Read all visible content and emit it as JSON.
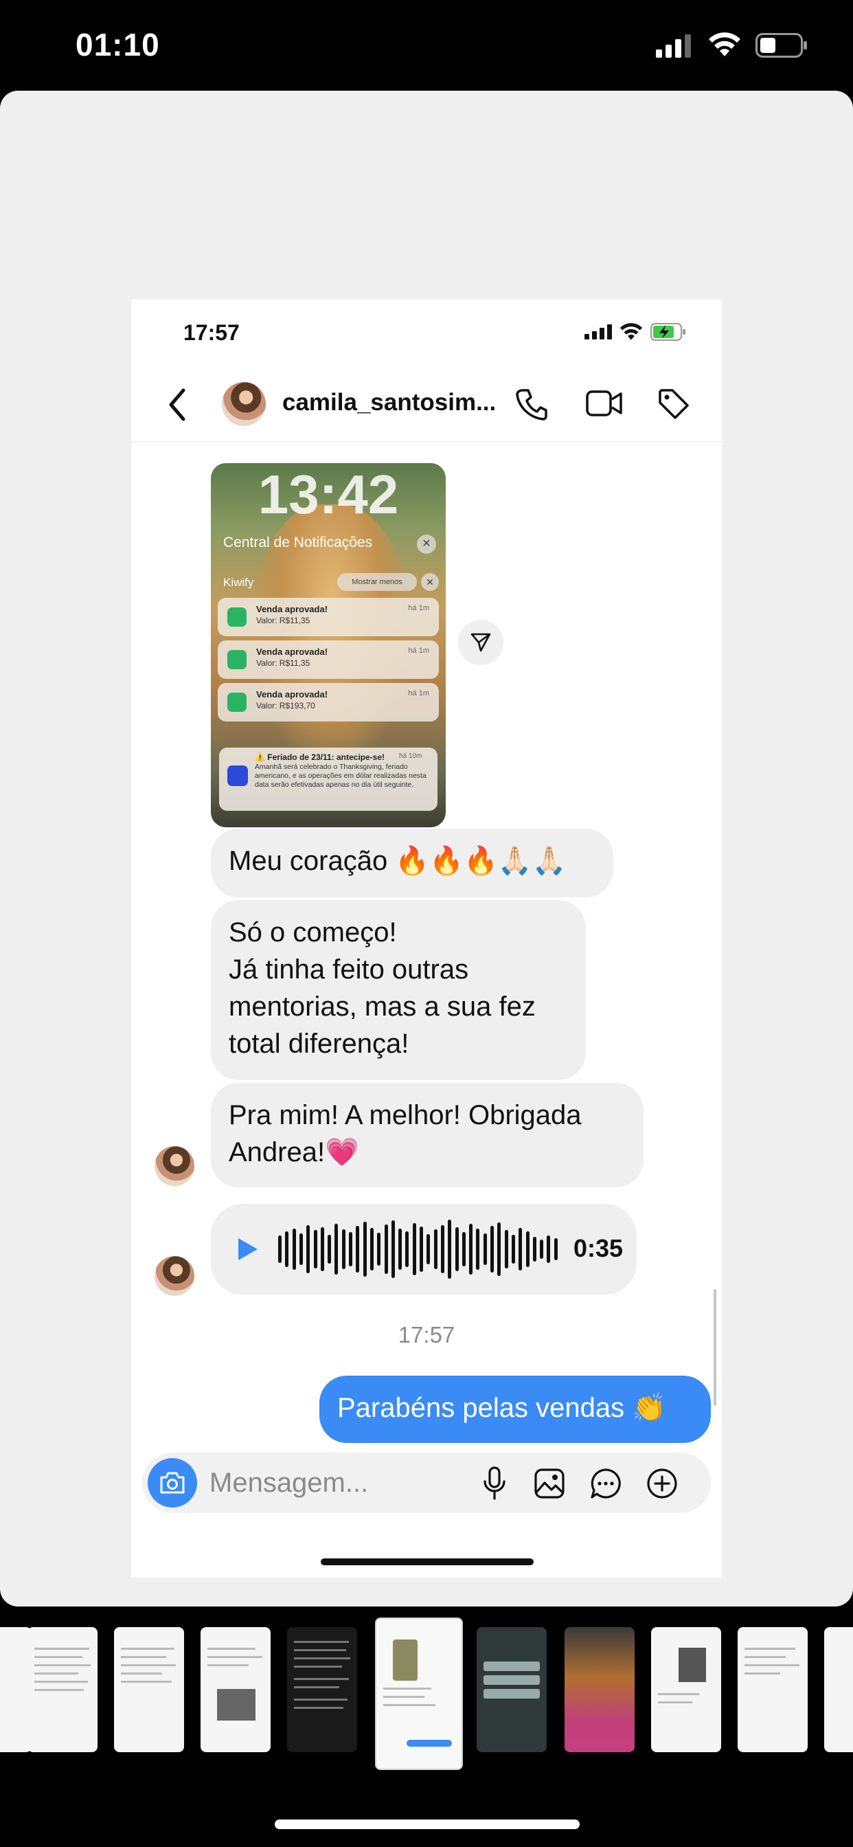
{
  "status_bar": {
    "time": "01:10"
  },
  "screenshot": {
    "status_time": "17:57",
    "header": {
      "username": "camila_santosim..."
    },
    "image_message": {
      "lock_time": "13:42",
      "notification_center": "Central de Notificações",
      "app_name": "Kiwify",
      "show_less": "Mostrar menos",
      "notifications": [
        {
          "title": "Venda aprovada!",
          "body": "Valor: R$11,35",
          "time": "há 1m"
        },
        {
          "title": "Venda aprovada!",
          "body": "Valor: R$11,35",
          "time": "há 1m"
        },
        {
          "title": "Venda aprovada!",
          "body": "Valor: R$193,70",
          "time": "há 1m"
        }
      ],
      "bank_notification": {
        "title": "⚠️ Feriado de 23/11: antecipe-se!",
        "body": "Amanhã será celebrado o Thanksgiving, feriado americano, e as operações em dólar realizadas nesta data serão efetivadas apenas no dia útil seguinte.",
        "time": "há 10m"
      }
    },
    "messages": [
      {
        "text": "Meu coração 🔥🔥🔥🙏🏻🙏🏻"
      },
      {
        "text": "Só o começo!\nJá tinha feito outras mentorias, mas a sua fez total diferença!"
      },
      {
        "text": "Pra mim! A melhor! Obrigada Andrea!💗"
      }
    ],
    "audio": {
      "duration": "0:35"
    },
    "timestamp": "17:57",
    "sent_message": {
      "text": "Parabéns pelas vendas 👏"
    },
    "composer": {
      "placeholder": "Mensagem..."
    },
    "colors": {
      "accent": "#3a8bf5",
      "bubble_in": "#efefef"
    }
  }
}
